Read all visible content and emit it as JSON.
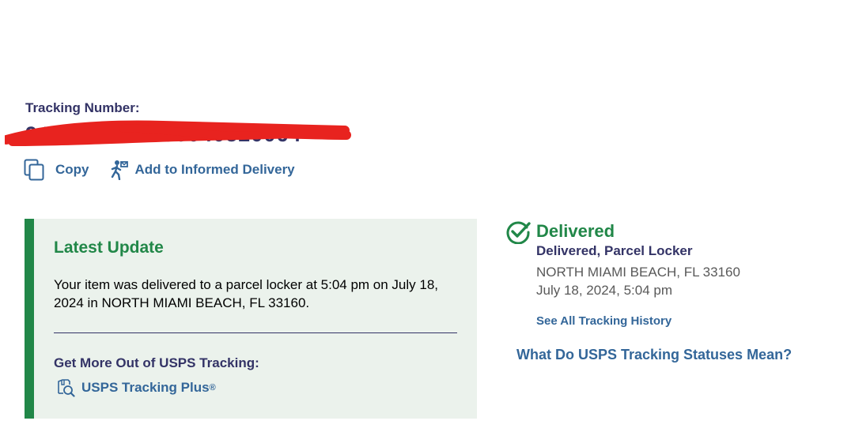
{
  "tracking": {
    "label": "Tracking Number:",
    "number": "9400111202000040520064"
  },
  "actions": {
    "copy_label": "Copy",
    "informed_label": "Add to Informed Delivery"
  },
  "latest_update": {
    "title": "Latest Update",
    "text": "Your item was delivered to a parcel locker at 5:04 pm on July 18, 2024 in NORTH MIAMI BEACH, FL 33160.",
    "more_title": "Get More Out of USPS Tracking:",
    "plus_link": "USPS Tracking Plus",
    "plus_mark": "®"
  },
  "status": {
    "title": "Delivered",
    "subtitle": "Delivered, Parcel Locker",
    "location": "NORTH MIAMI BEACH, FL 33160",
    "datetime": "July 18, 2024, 5:04 pm",
    "history_link": "See All Tracking History"
  },
  "statuses_link": "What Do USPS Tracking Statuses Mean?",
  "icons": {
    "copy": "copy-icon",
    "informed": "informed-delivery-icon",
    "plus": "tracking-plus-icon",
    "check": "check-circle-icon",
    "redaction": "red-scribble"
  },
  "colors": {
    "navy": "#333366",
    "link_blue": "#336699",
    "green": "#218748",
    "box_bg": "#ebf2ec",
    "redaction": "#e8231f"
  }
}
